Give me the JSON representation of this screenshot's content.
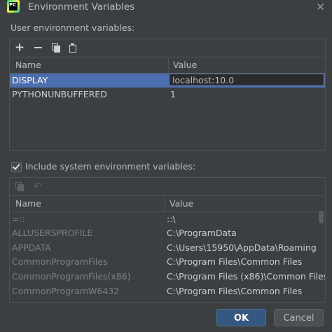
{
  "window": {
    "title": "Environment Variables",
    "app_icon_text": "PC"
  },
  "user_section": {
    "label": "User environment variables:",
    "toolbar": [
      "add-icon",
      "remove-icon",
      "copy-icon",
      "paste-icon"
    ],
    "columns": {
      "name": "Name",
      "value": "Value"
    },
    "rows": [
      {
        "name": "DISPLAY",
        "value": "localhost:10.0",
        "selected": true
      },
      {
        "name": "PYTHONUNBUFFERED",
        "value": "1",
        "selected": false
      }
    ]
  },
  "system_section": {
    "checkbox_label": "Include system environment variables:",
    "checked": true,
    "toolbar": [
      "copy-icon",
      "undo-icon"
    ],
    "columns": {
      "name": "Name",
      "value": "Value"
    },
    "rows": [
      {
        "name": "=::",
        "value": "::\\"
      },
      {
        "name": "ALLUSERSPROFILE",
        "value": "C:\\ProgramData"
      },
      {
        "name": "APPDATA",
        "value": "C:\\Users\\15950\\AppData\\Roaming"
      },
      {
        "name": "CommonProgramFiles",
        "value": "C:\\Program Files\\Common Files"
      },
      {
        "name": "CommonProgramFiles(x86)",
        "value": "C:\\Program Files (x86)\\Common Files"
      },
      {
        "name": "CommonProgramW6432",
        "value": "C:\\Program Files\\Common Files"
      }
    ]
  },
  "buttons": {
    "ok": "OK",
    "cancel": "Cancel"
  },
  "colors": {
    "background": "#3c3f41",
    "selection": "#4b6eaf",
    "ok_button": "#365880"
  }
}
